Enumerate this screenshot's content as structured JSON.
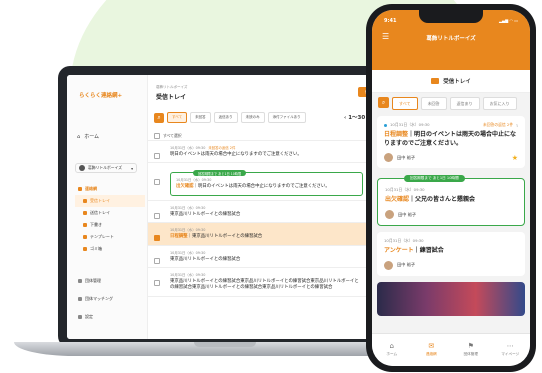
{
  "laptop": {
    "logo": "らくらく連絡網+",
    "home_label": "ホーム",
    "group_name": "葛飾リトルボーイズ",
    "menu_section": "連絡網",
    "menu_items": [
      {
        "label": "受信トレイ",
        "active": true
      },
      {
        "label": "送信トレイ",
        "active": false
      },
      {
        "label": "下書き",
        "active": false
      },
      {
        "label": "テンプレート",
        "active": false
      },
      {
        "label": "ゴミ箱",
        "active": false
      }
    ],
    "bottom_items": [
      {
        "label": "団体管理"
      },
      {
        "label": "団体マッチング"
      },
      {
        "label": "設定"
      }
    ],
    "breadcrumb": "葛飾リトルボーイズ",
    "title": "受信トレイ",
    "new_button": "作成",
    "filters": [
      "すべて",
      "未回答",
      "返信あり",
      "未読のみ",
      "添付ファイルあり"
    ],
    "pagination": "1～30",
    "select_all": "すべて選択",
    "rows": [
      {
        "meta": "10月31日（水）09:30",
        "badge": "未回答の返信 2件",
        "tag": "",
        "text": "明日のイベントは雨天の場合中止になりますのでご注意ください。"
      },
      {
        "meta": "10月31日（水）09:30",
        "badge": "",
        "tag": "出欠確認",
        "text": "明日のイベントは雨天の場合中止になりますのでご注意ください。",
        "pin": "回答期限まで あと1日 10時間"
      },
      {
        "meta": "10月31日（水）09:30",
        "badge": "",
        "tag": "",
        "text": "東京品川リトルボーイとの練習試合"
      },
      {
        "meta": "10月31日（水）09:30",
        "badge": "",
        "tag": "日程調整",
        "text": "東京品川リトルボーイとの練習試合",
        "highlight": true
      },
      {
        "meta": "10月31日（水）09:30",
        "badge": "",
        "tag": "",
        "text": "東京品川リトルボーイとの練習試合"
      },
      {
        "meta": "10月31日（水）09:30",
        "badge": "",
        "tag": "",
        "text": "東京品川リトルボーイとの練習試合東京品川リトルボーイとの練習試合東京品川リトルボーイとの練習試合東京品川リトルボーイとの練習試合東京品川リトルボーイとの練習試合"
      }
    ]
  },
  "phone": {
    "time": "9:41",
    "status_icons": "▂▄▆ ◠ ▭",
    "title": "葛飾リトルボーイズ",
    "subheader": "受信トレイ",
    "filters": [
      "すべて",
      "未回答",
      "返信あり",
      "お気に入り"
    ],
    "cards": [
      {
        "date": "10月31日（水）09:30",
        "unread": "未回答の返信 2件",
        "tag": "日程調整",
        "text": "明日のイベントは雨天の場合中止になりますのでご注意ください。",
        "user": "田中 裕子",
        "starred": true
      },
      {
        "date": "10月31日（水）09:30",
        "unread": "",
        "tag": "出欠確認",
        "text": "父兄の皆さんと懇親会",
        "user": "田中 裕子",
        "pin": "回答期限まで あと1日 10時間"
      },
      {
        "date": "10月31日（水）09:30",
        "unread": "",
        "tag": "アンケート",
        "text": "練習試合",
        "user": "田中 裕子"
      }
    ],
    "tabs": [
      {
        "label": "ホーム",
        "icon": "⌂"
      },
      {
        "label": "連絡網",
        "icon": "✉",
        "active": true
      },
      {
        "label": "団体管理",
        "icon": "⚑"
      },
      {
        "label": "マイページ",
        "icon": "⋯"
      }
    ]
  },
  "colors": {
    "accent": "#e8871e",
    "green": "#3aa84a",
    "background_blob": "#e9f6df"
  }
}
